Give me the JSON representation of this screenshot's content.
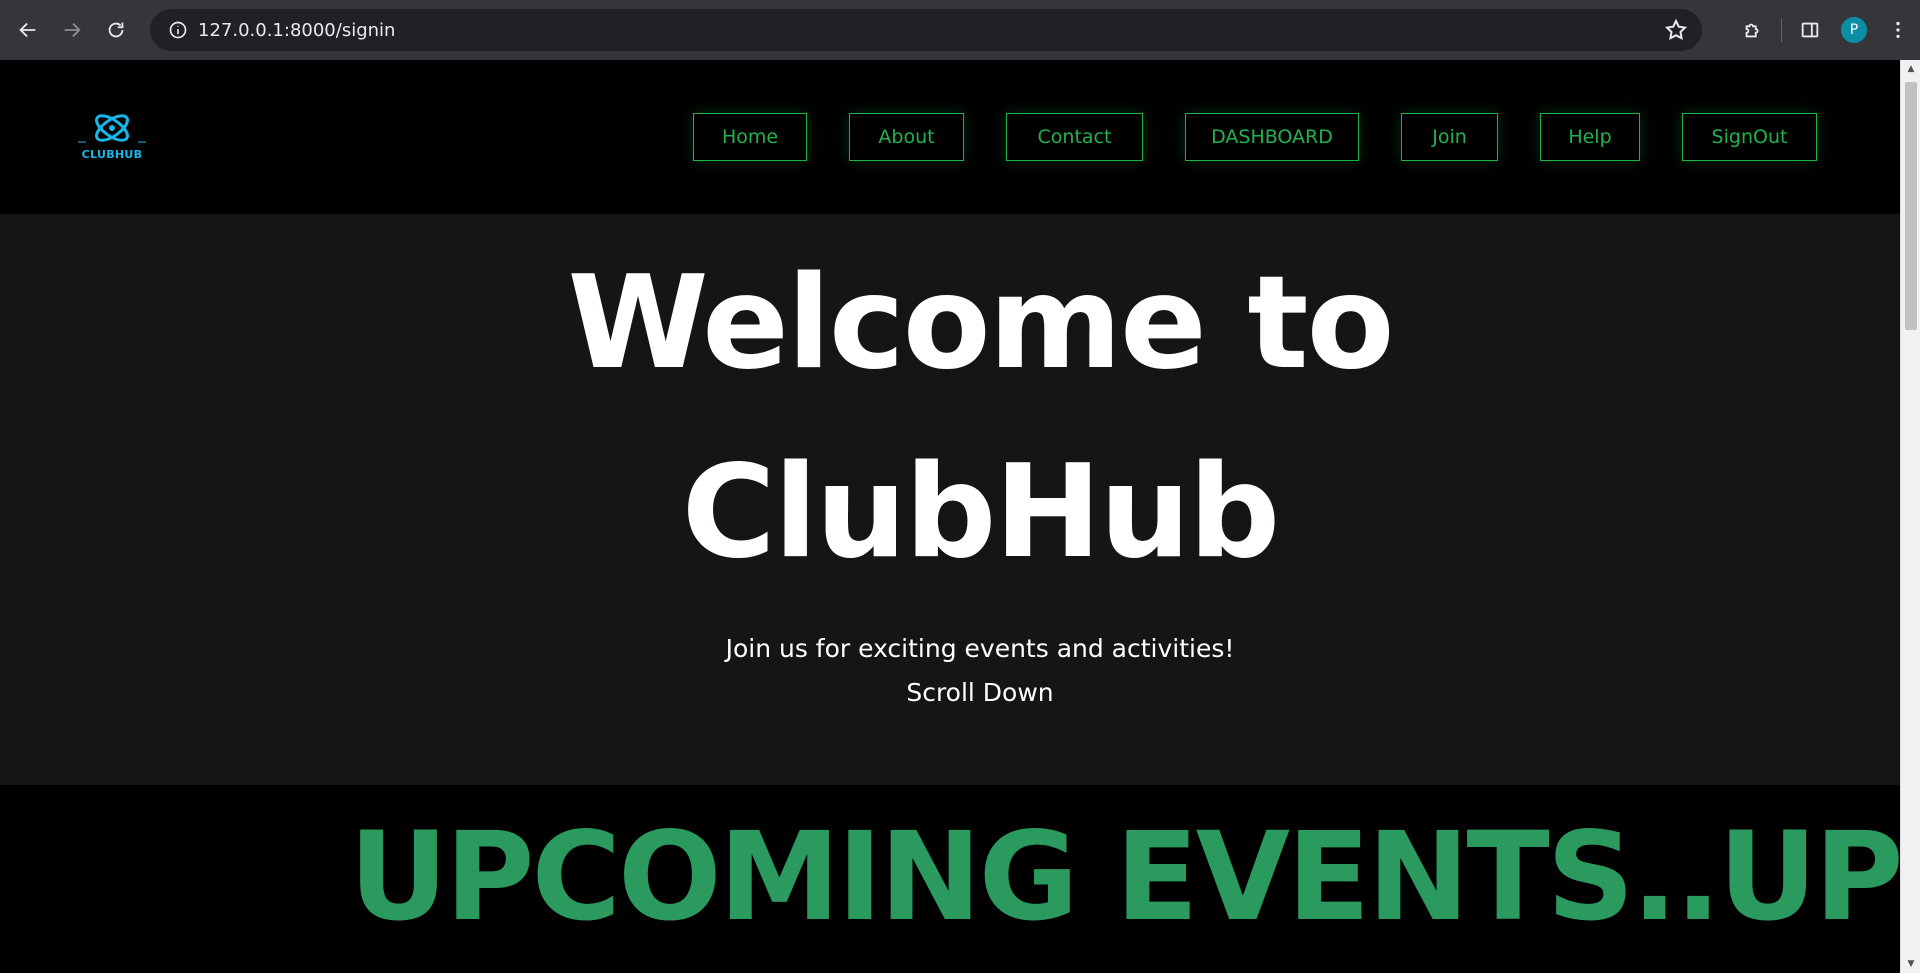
{
  "browser": {
    "url": "127.0.0.1:8000/signin",
    "profile_initial": "P"
  },
  "site": {
    "logo_text": "CLUBHUB",
    "nav": [
      {
        "label": "Home"
      },
      {
        "label": "About"
      },
      {
        "label": "Contact"
      },
      {
        "label": "DASHBOARD"
      },
      {
        "label": "Join"
      },
      {
        "label": "Help"
      },
      {
        "label": "SignOut"
      }
    ]
  },
  "hero": {
    "title_line1": "Welcome to",
    "title_line2": "ClubHub",
    "subtitle": "Join us for exciting events and activities!",
    "scroll_hint": "Scroll Down"
  },
  "events": {
    "marquee": "UPCOMING EVENTS..UPCOMING EVENTS.."
  },
  "colors": {
    "accent_green": "#1db24a",
    "marquee_green": "#2a9a5e",
    "logo_blue": "#15b8e8",
    "hero_bg": "#141517",
    "header_bg": "#000000"
  }
}
